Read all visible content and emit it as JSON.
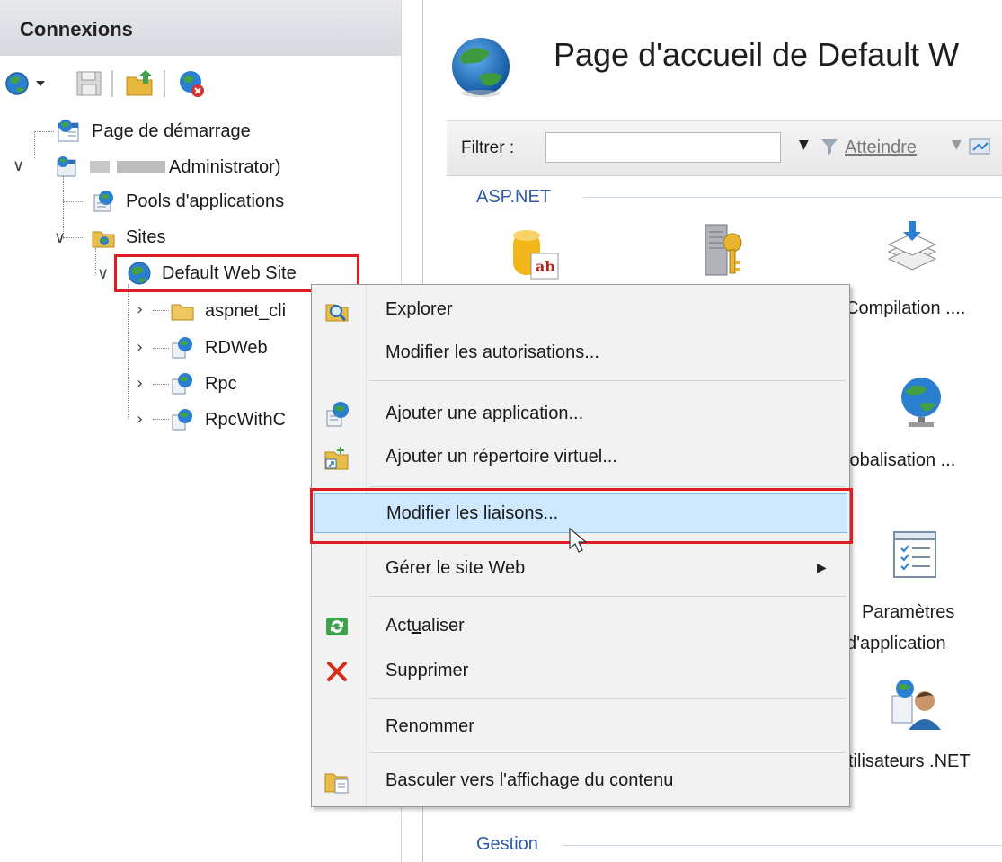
{
  "connections": {
    "title": "Connexions",
    "toolbar": [
      {
        "icon": "connect-globe-icon"
      },
      {
        "icon": "save-icon"
      },
      {
        "icon": "up-folder-icon"
      },
      {
        "icon": "disconnect-icon"
      }
    ]
  },
  "tree": {
    "start_page": "Page de démarrage",
    "server": "Administrator)",
    "app_pools": "Pools d'applications",
    "sites": "Sites",
    "default_site": "Default Web Site",
    "children": [
      "aspnet_cli",
      "RDWeb",
      "Rpc",
      "RpcWithC"
    ]
  },
  "main": {
    "title": "Page d'accueil de Default W",
    "filter": {
      "label": "Filtrer :",
      "value": "",
      "goto": "Atteindre"
    },
    "groups": [
      {
        "name": "ASP.NET"
      },
      {
        "name": "Gestion"
      }
    ],
    "features": [
      "Compilation ....",
      "lobalisation ...",
      "Paramètres",
      "d'application",
      "tilisateurs .NET"
    ]
  },
  "context_menu": {
    "items": [
      {
        "label": "Explorer",
        "icon": "explore-icon"
      },
      {
        "label": "Modifier les autorisations...",
        "icon": ""
      },
      {
        "label": "Ajouter une application...",
        "icon": "add-application-icon"
      },
      {
        "label": "Ajouter un répertoire virtuel...",
        "icon": "add-virtual-directory-icon"
      },
      {
        "label": "Modifier les liaisons...",
        "icon": "",
        "highlighted": true
      },
      {
        "label": "Gérer le site Web",
        "icon": "",
        "submenu": true
      },
      {
        "label_pre": "Act",
        "label_u": "u",
        "label_post": "aliser",
        "icon": "refresh-icon"
      },
      {
        "label": "Supprimer",
        "icon": "delete-icon"
      },
      {
        "label": "Renommer",
        "icon": ""
      },
      {
        "label": "Basculer vers l'affichage du contenu",
        "icon": "content-view-icon"
      }
    ]
  },
  "colors": {
    "highlight_outline": "#e01c24",
    "menu_hover": "#cde8ff",
    "group_heading": "#2e5aa8"
  }
}
